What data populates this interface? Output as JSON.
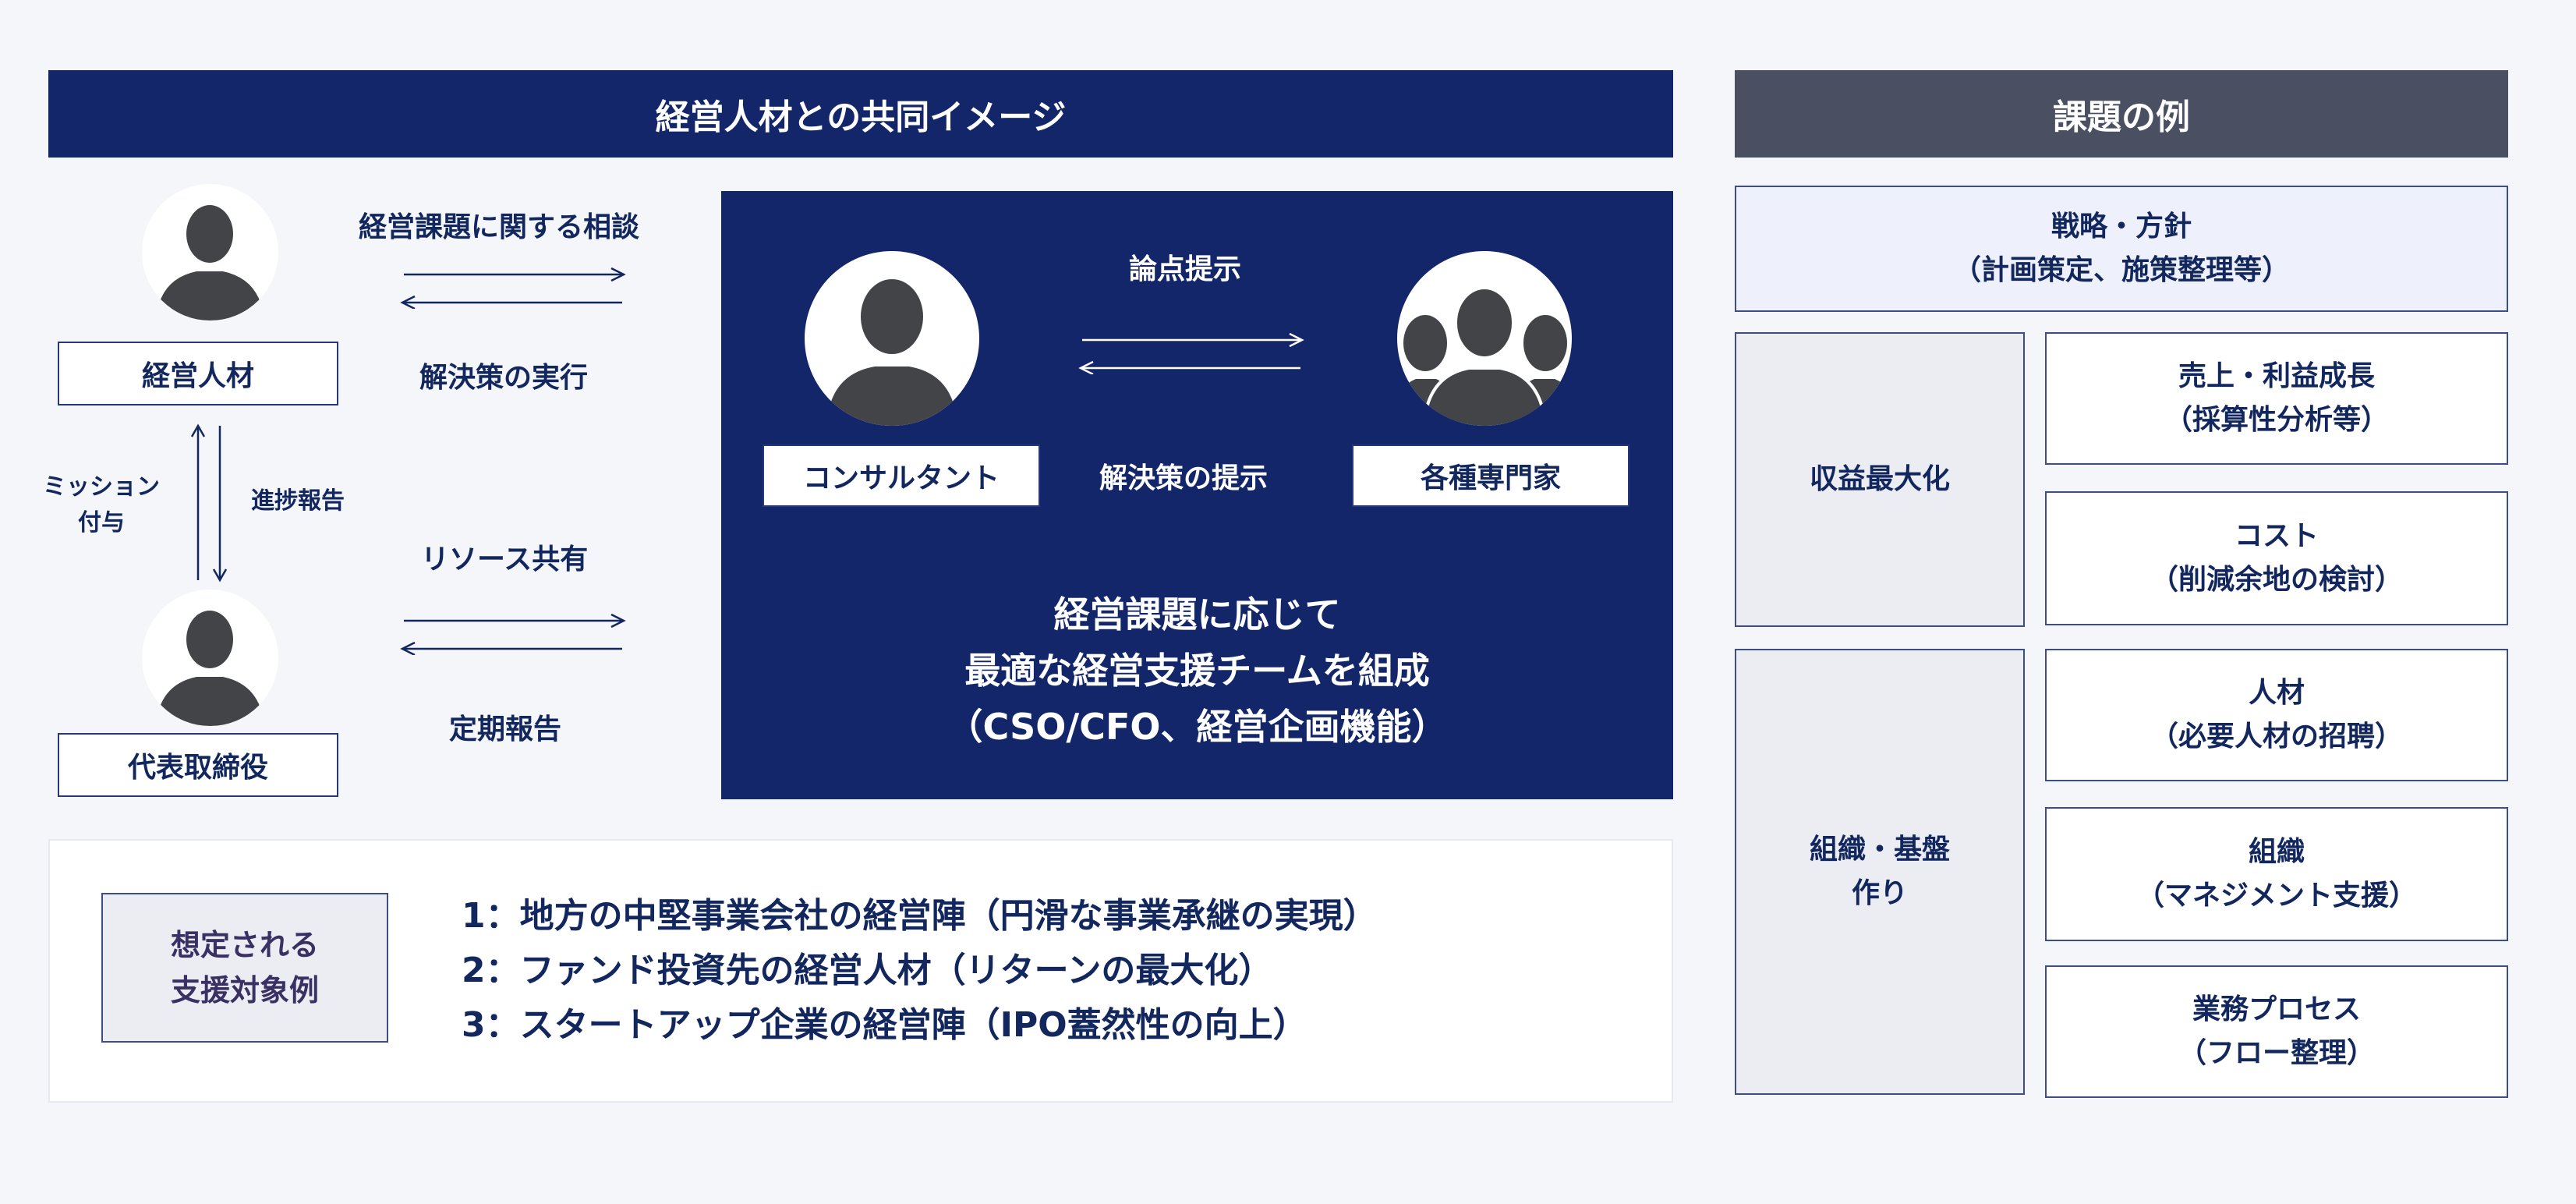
{
  "left_header": "経営人材との共同イメージ",
  "right_header": "課題の例",
  "roles": {
    "executive": "経営人材",
    "ceo": "代表取締役",
    "consultant": "コンサルタント",
    "experts": "各種専門家"
  },
  "flows": {
    "consult": "経営課題に関する相談",
    "execute": "解決策の実行",
    "resource": "リソース共有",
    "report": "定期報告",
    "mission_line1": "ミッション",
    "mission_line2": "付与",
    "progress": "進捗報告",
    "issues": "論点提示",
    "solution": "解決策の提示"
  },
  "team_text": {
    "line1": "経営課題に応じて",
    "line2": "最適な経営支援チームを組成",
    "line3": "（CSO/CFO、経営企画機能）"
  },
  "targets": {
    "label_line1": "想定される",
    "label_line2": "支援対象例",
    "items": [
      "1：地方の中堅事業会社の経営陣（円滑な事業承継の実現）",
      "2：ファンド投資先の経営人材（リターンの最大化）",
      "3：スタートアップ企業の経営陣（IPO蓋然性の向上）"
    ]
  },
  "issues": {
    "strategy": {
      "line1": "戦略・方針",
      "line2": "（計画策定、施策整理等）"
    },
    "revenue_category": "収益最大化",
    "org_category_line1": "組織・基盤",
    "org_category_line2": "作り",
    "sales": {
      "line1": "売上・利益成長",
      "line2": "（採算性分析等）"
    },
    "cost": {
      "line1": "コスト",
      "line2": "（削減余地の検討）"
    },
    "talent": {
      "line1": "人材",
      "line2": "（必要人材の招聘）"
    },
    "organization": {
      "line1": "組織",
      "line2": "（マネジメント支援）"
    },
    "process": {
      "line1": "業務プロセス",
      "line2": "（フロー整理）"
    }
  },
  "colors": {
    "navy": "#13266a",
    "header_gray": "#4a5062",
    "strategy_bg": "#eef1fc",
    "category_bg": "#ebedf2",
    "silhouette": "#434448"
  }
}
